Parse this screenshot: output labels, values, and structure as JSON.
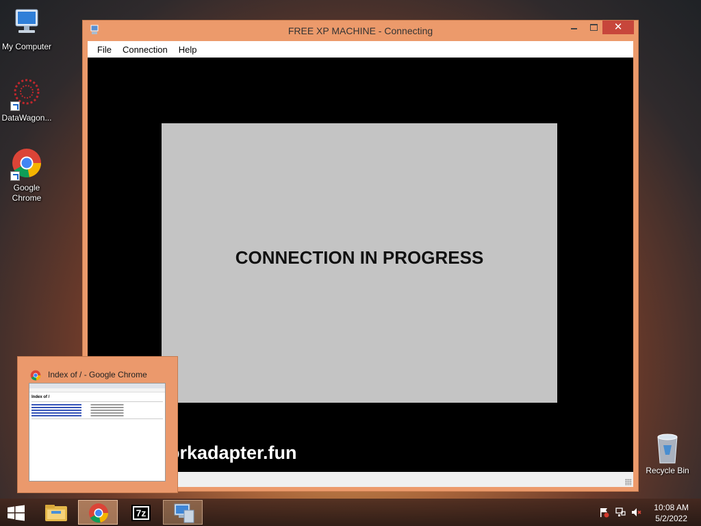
{
  "desktop": {
    "icons": [
      {
        "label": "My Computer"
      },
      {
        "label": "DataWagon..."
      },
      {
        "label": "Google Chrome"
      }
    ],
    "recycle_bin": "Recycle Bin"
  },
  "window": {
    "title": "FREE XP MACHINE - Connecting",
    "close_glyph": "✕",
    "menu": [
      "File",
      "Connection",
      "Help"
    ],
    "connection_message": "CONNECTION IN PROGRESS",
    "url_fragment": "orkadapter.fun"
  },
  "thumbnail": {
    "title": "Index of / - Google Chrome",
    "preview_heading": "Index of /"
  },
  "taskbar": {
    "buttons": [
      {
        "name": "file-explorer",
        "icon": "folder-icon"
      },
      {
        "name": "google-chrome",
        "icon": "chrome-icon"
      },
      {
        "name": "7zip",
        "icon": "7zip-icon",
        "label": "7z"
      },
      {
        "name": "remote-desktop",
        "icon": "remote-computer-icon"
      }
    ],
    "clock": {
      "time": "10:08 AM",
      "date": "5/2/2022"
    }
  },
  "colors": {
    "window_frame": "#ec9a6b",
    "close_button": "#c7463b",
    "connection_panel": "#c4c4c4"
  }
}
